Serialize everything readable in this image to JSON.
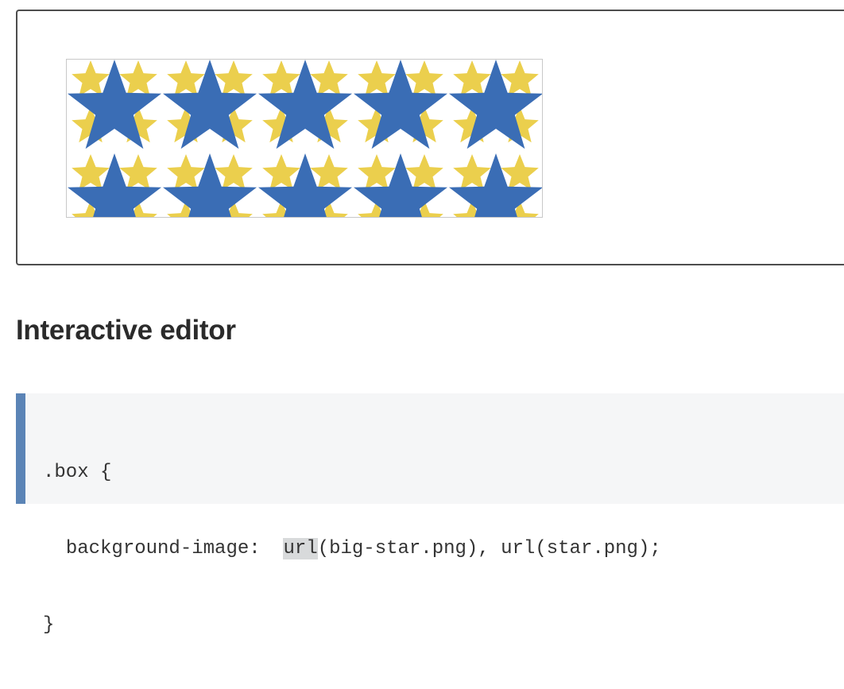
{
  "output": {
    "demo_box": {
      "layers": [
        {
          "name": "big-star",
          "icon": "big-star-icon",
          "color": "#3a6db5"
        },
        {
          "name": "star",
          "icon": "star-icon",
          "color": "#ebcf4d"
        }
      ]
    }
  },
  "heading": "Interactive editor",
  "editor": {
    "line1": ".box {",
    "line2_indent": "  ",
    "line2_prop": "background-image:",
    "line2_gap": "  ",
    "line2_url1_fn": "url",
    "line2_url1_rest": "(big-star.png), url(star.png);",
    "line3": "}"
  }
}
